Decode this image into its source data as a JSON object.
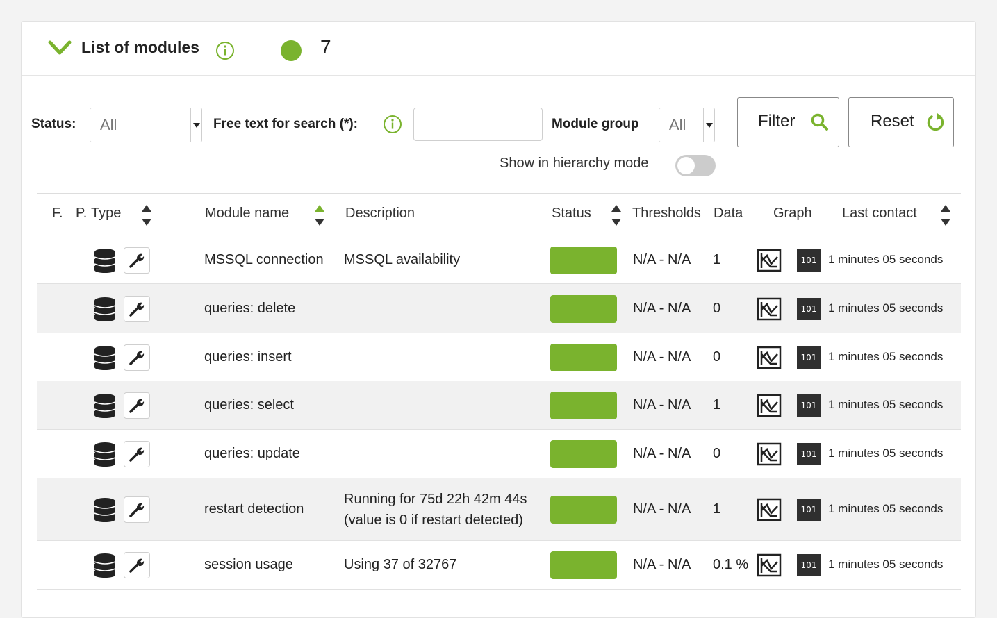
{
  "header": {
    "title": "List of modules",
    "count": "7",
    "count_color": "#7ab32e",
    "icons": [
      "chevron-down-icon",
      "info-icon"
    ]
  },
  "filters": {
    "status_label": "Status:",
    "status_value": "All",
    "search_label": "Free text for search (*):",
    "search_value": "",
    "module_group_label": "Module group",
    "module_group_value": "All",
    "hierarchy_label": "Show in hierarchy mode",
    "hierarchy_enabled": false,
    "filter_button": "Filter",
    "reset_button": "Reset"
  },
  "table": {
    "columns": [
      "F.",
      "P.",
      "Type",
      "Module name",
      "Description",
      "Status",
      "Thresholds",
      "Data",
      "Graph",
      "Last contact"
    ],
    "rows": [
      {
        "name": "MSSQL connection",
        "description_line1": "MSSQL availability",
        "description_line2": "",
        "thresholds": "N/A - N/A",
        "data": "1",
        "last_contact": "1 minutes 05 seconds"
      },
      {
        "name": "queries: delete",
        "description_line1": "",
        "description_line2": "",
        "thresholds": "N/A - N/A",
        "data": "0",
        "last_contact": "1 minutes 05 seconds"
      },
      {
        "name": "queries: insert",
        "description_line1": "",
        "description_line2": "",
        "thresholds": "N/A - N/A",
        "data": "0",
        "last_contact": "1 minutes 05 seconds"
      },
      {
        "name": "queries: select",
        "description_line1": "",
        "description_line2": "",
        "thresholds": "N/A - N/A",
        "data": "1",
        "last_contact": "1 minutes 05 seconds"
      },
      {
        "name": "queries: update",
        "description_line1": "",
        "description_line2": "",
        "thresholds": "N/A - N/A",
        "data": "0",
        "last_contact": "1 minutes 05 seconds"
      },
      {
        "name": "restart detection",
        "description_line1": "Running for 75d 22h 42m 44s",
        "description_line2": "(value is 0 if restart detected)",
        "thresholds": "N/A - N/A",
        "data": "1",
        "last_contact": "1 minutes 05 seconds"
      },
      {
        "name": "session usage",
        "description_line1": "Using 37 of 32767",
        "description_line2": "",
        "thresholds": "N/A - N/A",
        "data": "0.1 %",
        "last_contact": "1 minutes 05 seconds"
      }
    ],
    "status_color": "#7ab32e",
    "data_icon_label": "101"
  },
  "colors": {
    "accent": "#7ab32e"
  }
}
